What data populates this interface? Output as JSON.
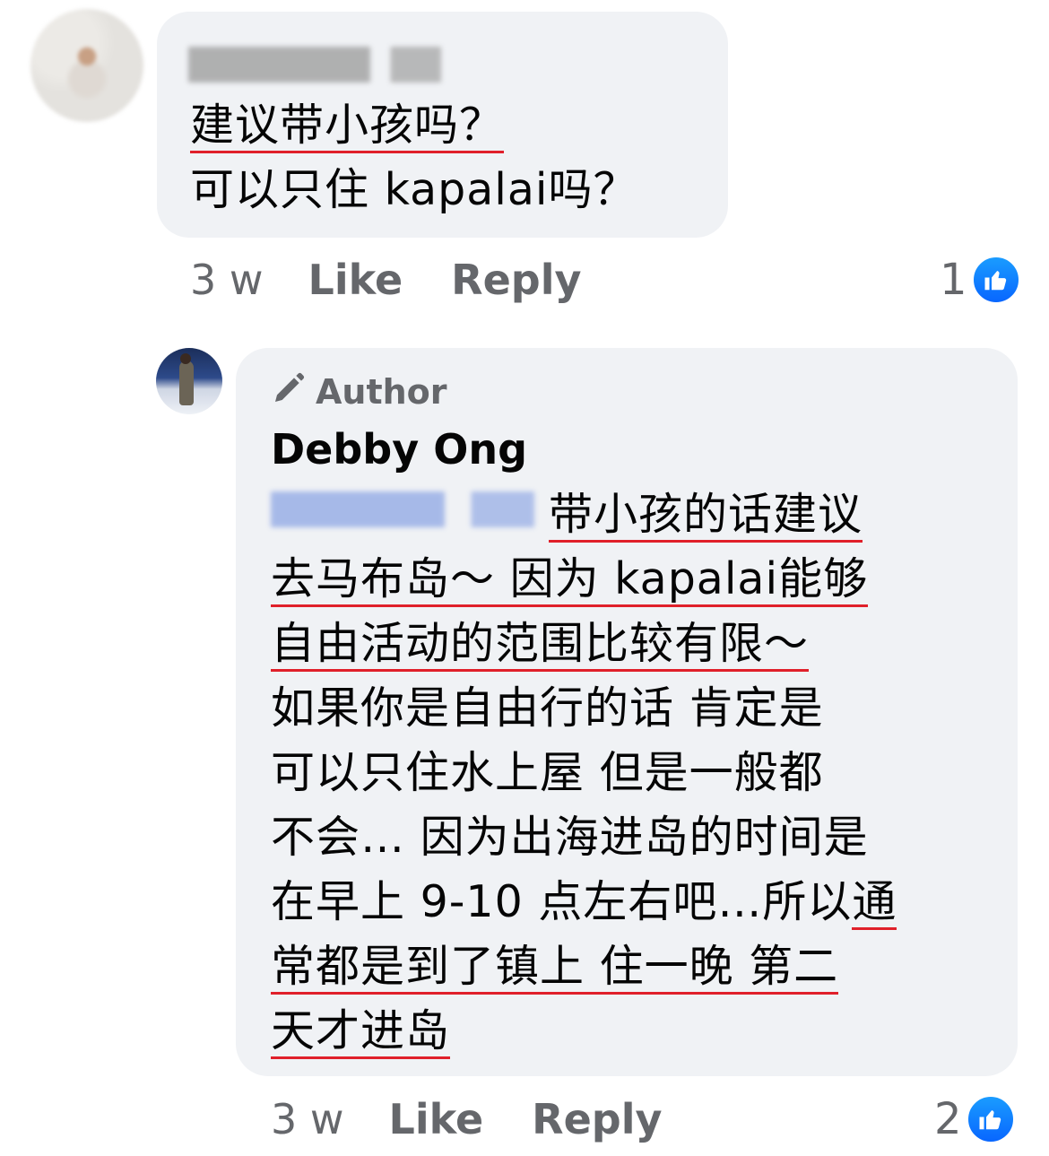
{
  "comment": {
    "text_lines": [
      "建议带小孩吗？",
      "可以只住 kapalai吗？"
    ],
    "time": "3 w",
    "like_label": "Like",
    "reply_label": "Reply",
    "reaction_count": "1"
  },
  "reply": {
    "badge_label": "Author",
    "author_name": "Debby Ong",
    "lines": [
      "带小孩的话建议",
      "去马布岛～ 因为 kapalai能够",
      "自由活动的范围比较有限～",
      "如果你是自由行的话 肯定是",
      "可以只住水上屋 但是一般都",
      "不会… 因为出海进岛的时间是",
      "在早上 9-10 点左右吧…所以",
      "通",
      "常都是到了镇上 住一晚 第二",
      "天才进岛"
    ],
    "time": "3 w",
    "like_label": "Like",
    "reply_label": "Reply",
    "reaction_count": "2"
  },
  "colors": {
    "bubble": "#f0f2f5",
    "secondary_text": "#65676b",
    "like_blue": "#0866ff",
    "underline_red": "#e0202a"
  },
  "icons": {
    "author_badge": "pencil-icon",
    "reaction": "thumbs-up-icon"
  }
}
